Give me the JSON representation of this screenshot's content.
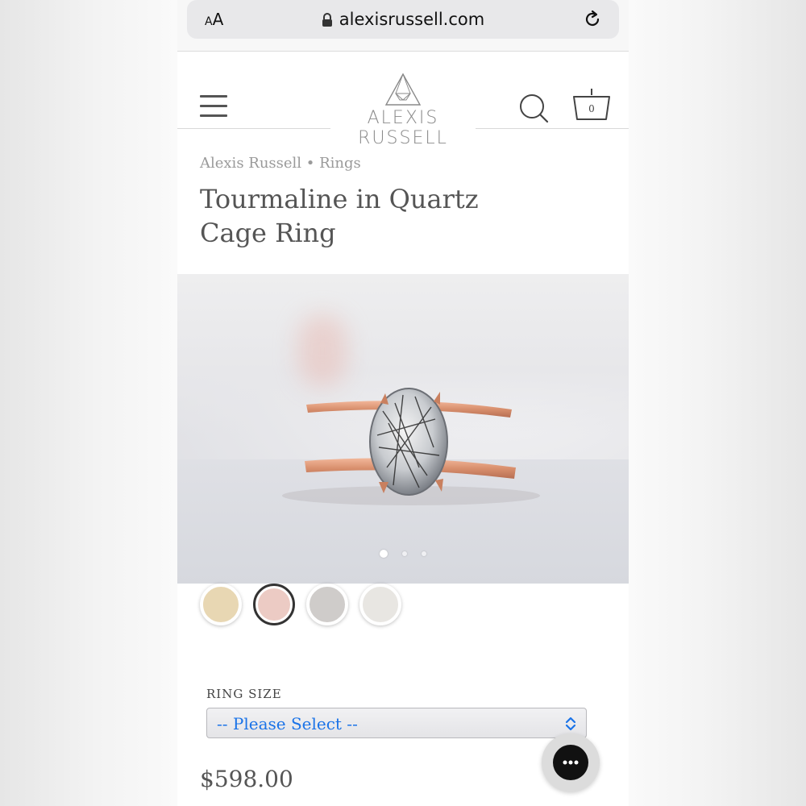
{
  "browser": {
    "text_size_label": "AA",
    "url": "alexisrussell.com"
  },
  "header": {
    "logo_text": "ALEXIS RUSSELL",
    "cart_count": "0"
  },
  "breadcrumb": "Alexis Russell • Rings",
  "product": {
    "title_line1": "Tourmaline in Quartz",
    "title_line2": "Cage Ring",
    "carousel_count": 3,
    "carousel_active_index": 0,
    "swatches": [
      {
        "color": "#e8d7b3"
      },
      {
        "color": "#eccbc4",
        "selected": true
      },
      {
        "color": "#cfccca"
      },
      {
        "color": "#e8e6e2"
      }
    ],
    "ring_size_label": "RING SIZE",
    "ring_size_value": "-- Please Select --",
    "price": "$598.00"
  },
  "colors": {
    "link_blue": "#1a73e8",
    "title_gray": "#555555"
  }
}
